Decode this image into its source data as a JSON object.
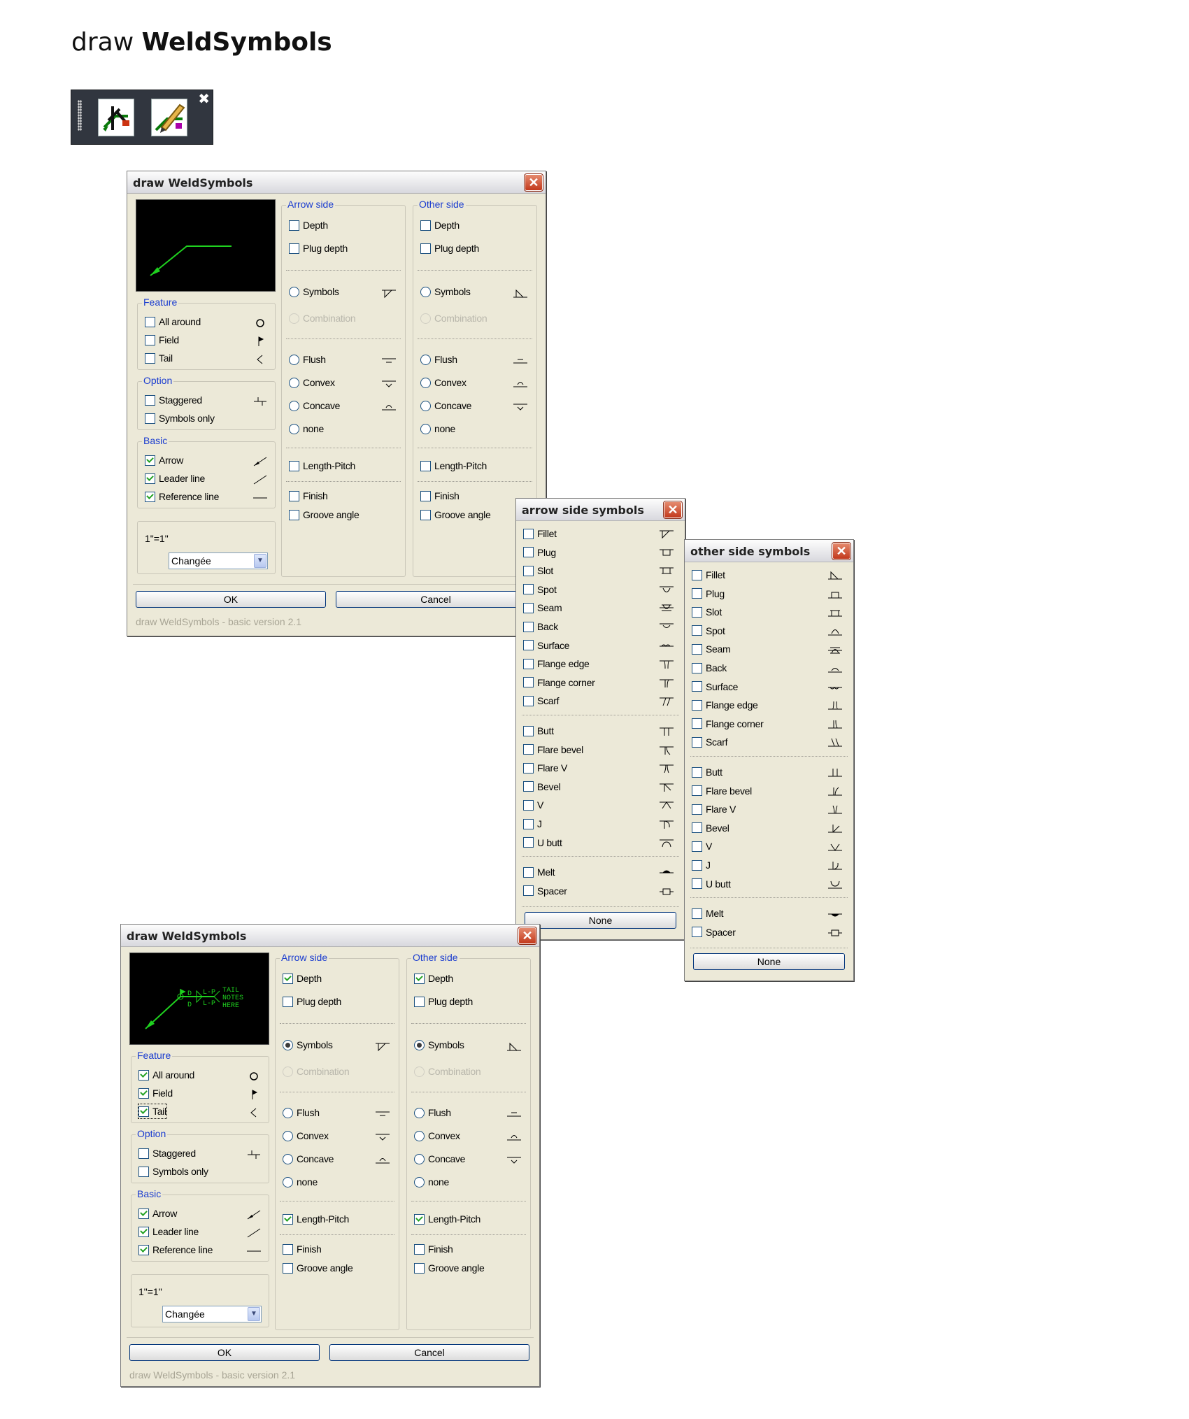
{
  "page": {
    "title_prefix": "draw",
    "title_bold": "WeldSymbols"
  },
  "toolbar": {
    "close_glyph": "✖",
    "buttons": [
      "weld-symbol-draw-icon",
      "weld-symbol-edit-icon"
    ]
  },
  "main_dialog": {
    "title": "draw WeldSymbols",
    "close_glyph": "✕",
    "feature": {
      "label": "Feature",
      "items": [
        "All around",
        "Field",
        "Tail"
      ]
    },
    "option": {
      "label": "Option",
      "items": [
        "Staggered",
        "Symbols only"
      ]
    },
    "basic": {
      "label": "Basic",
      "items": [
        "Arrow",
        "Leader line",
        "Reference line"
      ]
    },
    "scale_label": "1\"=1\"",
    "scale_value": "Changée",
    "arrow_side": {
      "label": "Arrow side"
    },
    "other_side": {
      "label": "Other side"
    },
    "side_items": {
      "depth": "Depth",
      "plug_depth": "Plug depth",
      "symbols": "Symbols",
      "combination": "Combination",
      "flush": "Flush",
      "convex": "Convex",
      "concave": "Concave",
      "none": "none",
      "length_pitch": "Length-Pitch",
      "finish": "Finish",
      "groove_angle": "Groove angle"
    },
    "ok": "OK",
    "cancel": "Cancel",
    "version": "draw WeldSymbols - basic version 2.1",
    "preview_notes": [
      "D",
      "D",
      "L-P",
      "L-P",
      "TAIL",
      "NOTES",
      "HERE"
    ]
  },
  "states": {
    "top": {
      "all_around": false,
      "field": false,
      "tail": false,
      "arrow": true,
      "leader": true,
      "reference": true,
      "depth": false,
      "symbols": false,
      "length_pitch": false
    },
    "bottom": {
      "all_around": true,
      "field": true,
      "tail": true,
      "arrow": true,
      "leader": true,
      "reference": true,
      "depth": true,
      "symbols": true,
      "length_pitch": true
    }
  },
  "arrow_symbols_dialog": {
    "title": "arrow side symbols",
    "group1": [
      "Fillet",
      "Plug",
      "Slot",
      "Spot",
      "Seam",
      "Back",
      "Surface",
      "Flange edge",
      "Flange corner",
      "Scarf"
    ],
    "group2": [
      "Butt",
      "Flare bevel",
      "Flare V",
      "Bevel",
      "V",
      "J",
      "U butt"
    ],
    "group3": [
      "Melt",
      "Spacer"
    ],
    "none_button": "None"
  },
  "other_symbols_dialog": {
    "title": "other side symbols",
    "group1": [
      "Fillet",
      "Plug",
      "Slot",
      "Spot",
      "Seam",
      "Back",
      "Surface",
      "Flange edge",
      "Flange corner",
      "Scarf"
    ],
    "group2": [
      "Butt",
      "Flare bevel",
      "Flare V",
      "Bevel",
      "V",
      "J",
      "U butt"
    ],
    "group3": [
      "Melt",
      "Spacer"
    ],
    "none_button": "None"
  },
  "colors": {
    "dialog_bg": "#ece9d8",
    "group_label": "#1a3ccf",
    "preview_line": "#1fd11f",
    "close_red": "#c2391c"
  }
}
